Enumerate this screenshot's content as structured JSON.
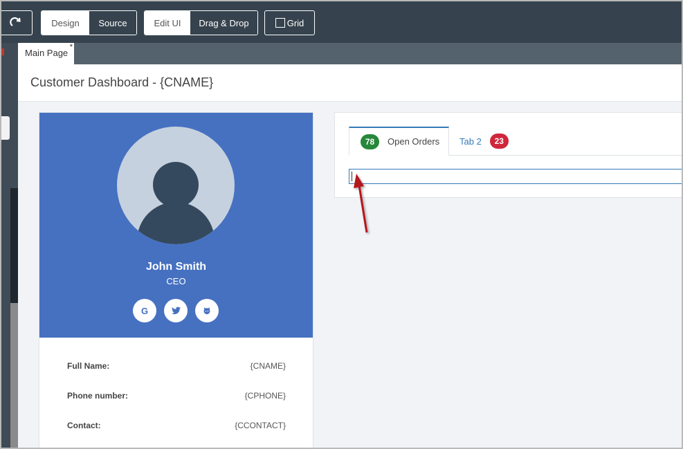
{
  "toolbar": {
    "redo_icon": "redo-icon",
    "view_mode": {
      "design": "Design",
      "source": "Source",
      "active": "Source"
    },
    "edit_mode": {
      "edit_ui": "Edit UI",
      "drag_drop": "Drag & Drop",
      "active": "Drag & Drop"
    },
    "grid": {
      "label": "Grid",
      "checked": false
    }
  },
  "tabs": {
    "page_tab": "Main Page",
    "modified_marker": "*"
  },
  "page": {
    "title": "Customer Dashboard - {CNAME}"
  },
  "profile": {
    "name": "John Smith",
    "role": "CEO",
    "social_icons": [
      "google-icon",
      "twitter-icon",
      "github-icon"
    ],
    "social_glyphs": [
      "G",
      "🐦",
      "◉"
    ],
    "fields": [
      {
        "label": "Full Name:",
        "value": "{CNAME}"
      },
      {
        "label": "Phone number:",
        "value": "{CPHONE}"
      },
      {
        "label": "Contact:",
        "value": "{CCONTACT}"
      }
    ]
  },
  "order_tabs": [
    {
      "label": "Open Orders",
      "badge": "78",
      "badge_color": "#27873a",
      "active": true
    },
    {
      "label": "Tab 2",
      "badge": "23",
      "badge_color": "#d0263b",
      "active": false
    }
  ],
  "colors": {
    "toolbar_bg": "#36434e",
    "profile_bg": "#4671c1",
    "link_blue": "#337ab7",
    "annotation_arrow": "#b5161e"
  }
}
